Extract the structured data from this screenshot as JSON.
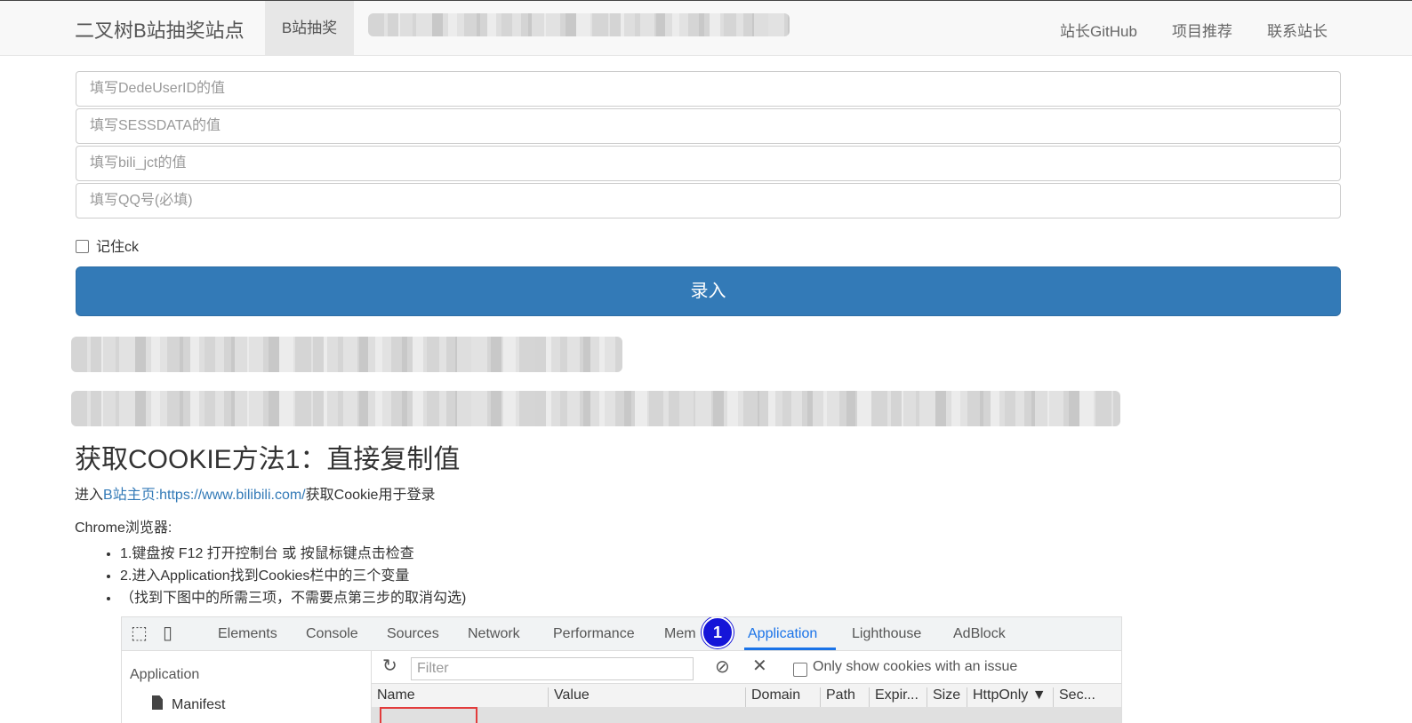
{
  "navbar": {
    "brand": "二叉树B站抽奖站点",
    "active_tab": "B站抽奖",
    "right_links": [
      "站长GitHub",
      "项目推荐",
      "联系站长"
    ]
  },
  "form": {
    "dedeuserid_placeholder": "填写DedeUserID的值",
    "sessdata_placeholder": "填写SESSDATA的值",
    "bili_jct_placeholder": "填写bili_jct的值",
    "qq_placeholder": "填写QQ号(必填)",
    "remember_label": "记住ck",
    "remember_checked": false,
    "submit_label": "录入"
  },
  "content": {
    "heading": "获取COOKIE方法1：直接复制值",
    "intro_prefix": "进入",
    "intro_link": "B站主页:https://www.bilibili.com/",
    "intro_suffix": "获取Cookie用于登录",
    "browser_label": "Chrome浏览器:",
    "steps": [
      "1.键盘按 F12 打开控制台 或 按鼠标键点击检查",
      "2.进入Application找到Cookies栏中的三个变量",
      "（找到下图中的所需三项，不需要点第三步的取消勾选)"
    ]
  },
  "devtools": {
    "tabs": [
      "Elements",
      "Console",
      "Sources",
      "Network",
      "Performance",
      "Mem",
      "Application",
      "Lighthouse",
      "AdBlock"
    ],
    "active_tab": "Application",
    "badge_1": "1",
    "sidebar_title": "Application",
    "sidebar_item": "Manifest",
    "filter_placeholder": "Filter",
    "only_issue_label": "Only show cookies with an issue",
    "columns": [
      "Name",
      "Value",
      "Domain",
      "Path",
      "Expir...",
      "Size",
      "HttpOnly ▼",
      "Sec..."
    ]
  },
  "colors": {
    "primary": "#337ab7",
    "navbar_bg": "#f8f8f8",
    "devtools_accent": "#1a73e8",
    "badge": "#1515d8"
  }
}
